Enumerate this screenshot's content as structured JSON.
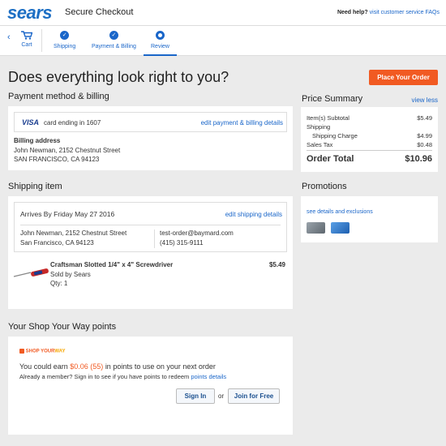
{
  "header": {
    "logo": "sears",
    "title": "Secure Checkout",
    "help_prefix": "Need help?",
    "help_link": "visit customer service FAQs"
  },
  "steps": {
    "back": "‹",
    "cart_label": "Cart",
    "items": [
      {
        "label": "Shipping",
        "state": "done"
      },
      {
        "label": "Payment & Billing",
        "state": "done"
      },
      {
        "label": "Review",
        "state": "current"
      }
    ]
  },
  "main": {
    "heading": "Does everything look right to you?",
    "place_order": "Place Your Order"
  },
  "payment": {
    "title": "Payment method & billing",
    "card_brand": "VISA",
    "card_text": "card ending in 1607",
    "edit_link": "edit payment & billing details",
    "billing_label": "Billing address",
    "billing_line1": "John Newman, 2152 Chestnut Street",
    "billing_line2": "SAN FRANCISCO, CA 94123"
  },
  "shipping": {
    "title": "Shipping item",
    "arrives": "Arrives By Friday May 27 2016",
    "edit_link": "edit shipping details",
    "addr_line1": "John Newman, 2152 Chestnut Street",
    "addr_line2": "San Francisco, CA 94123",
    "email": "test-order@baymard.com",
    "phone": "(415) 315-9111",
    "item_name": "Craftsman Slotted 1/4\" x 4\" Screwdriver",
    "item_seller": "Sold by Sears",
    "item_qty": "Qty: 1",
    "item_price": "$5.49"
  },
  "syw": {
    "title": "Your Shop Your Way points",
    "logo_a": "SHOP",
    "logo_b": "YOUR",
    "logo_c": "WAY",
    "earn_prefix": "You could earn",
    "earn_amount": "$0.06",
    "earn_points": "(55)",
    "earn_suffix": "in points to use on your next order",
    "member_text": "Already a member? Sign in to see if you have points to redeem",
    "points_link": "points details",
    "signin": "Sign In",
    "or": "or",
    "join": "Join for Free"
  },
  "summary": {
    "title": "Price Summary",
    "view_less": "view less",
    "subtotal_label": "Item(s) Subtotal",
    "subtotal": "$5.49",
    "shipping_label": "Shipping",
    "charge_label": "Shipping Charge",
    "charge": "$4.99",
    "tax_label": "Sales Tax",
    "tax": "$0.48",
    "total_label": "Order Total",
    "total": "$10.96"
  },
  "promotions": {
    "title": "Promotions",
    "link": "see details and exclusions"
  },
  "colors": {
    "accent": "#1a66c9",
    "orange": "#f15a22"
  }
}
